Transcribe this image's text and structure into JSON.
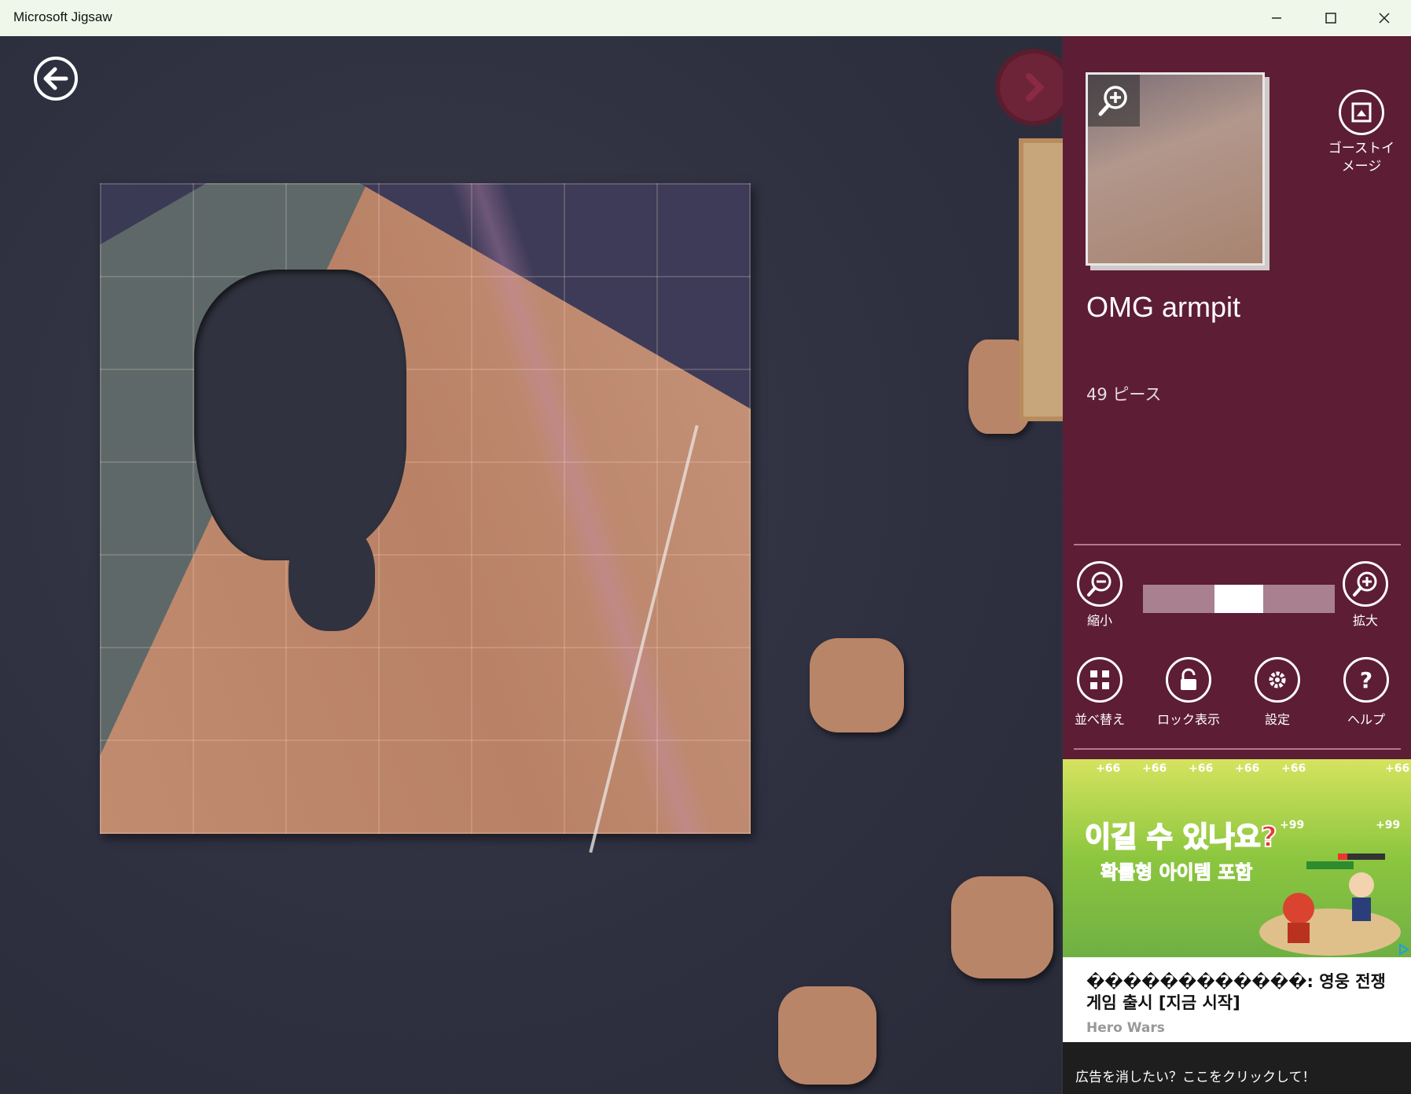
{
  "window": {
    "title": "Microsoft Jigsaw",
    "minimize": "—",
    "maximize": "☐",
    "close": "✕"
  },
  "puzzle": {
    "name": "OMG armpit",
    "pieces_label": "49 ピース"
  },
  "panel": {
    "ghost_label": "ゴーストイメージ",
    "zoom_out_label": "縮小",
    "zoom_in_label": "拡大",
    "zoom_level": 0.5,
    "tools": [
      {
        "label": "並べ替え",
        "icon": "arrange-icon"
      },
      {
        "label": "ロック表示",
        "icon": "lock-icon"
      },
      {
        "label": "設定",
        "icon": "gear-icon"
      },
      {
        "label": "ヘルプ",
        "icon": "help-icon"
      }
    ]
  },
  "ad": {
    "banner_headline": "이길 수 있나요?",
    "banner_sub": "확률형 아이템 포함",
    "plus_values": [
      "+66",
      "+66",
      "+66",
      "+66",
      "+66",
      "+66"
    ],
    "plus99": [
      "+99",
      "+99"
    ],
    "text": "������������: 영웅 전쟁 게임 출시 [지금 시작]",
    "source": "Hero Wars",
    "remove_ads": "広告を消したい？ここをクリックして！"
  },
  "colors": {
    "panel": "#5d1d35",
    "board": "#2f3140",
    "piece": "#b98568"
  }
}
